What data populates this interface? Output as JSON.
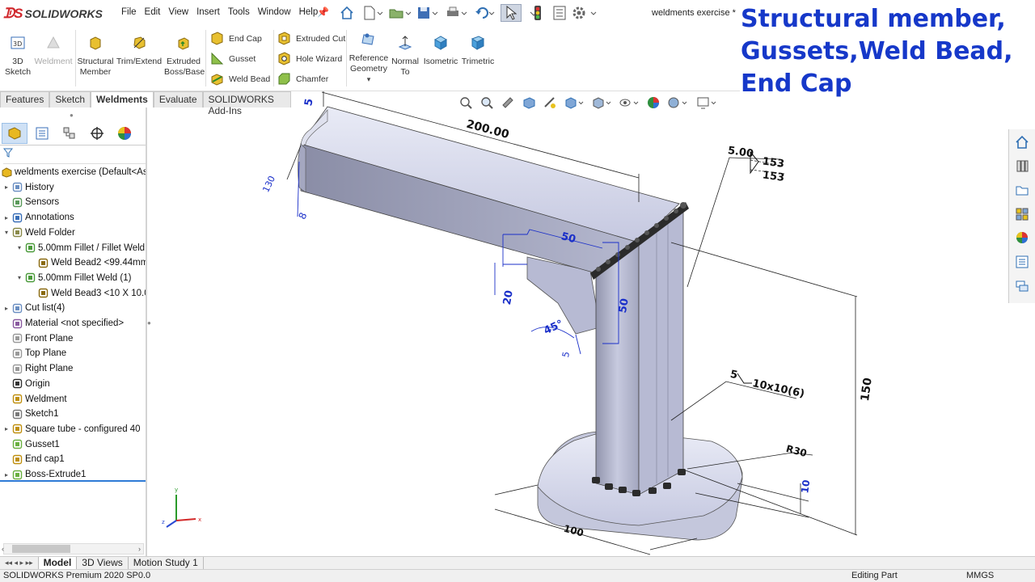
{
  "app": {
    "logo_text": "SOLIDWORKS",
    "document_title": "weldments exercise *",
    "overlay_title": [
      "Structural member,",
      "Gussets,Weld Bead,",
      "End Cap"
    ]
  },
  "menu": [
    "File",
    "Edit",
    "View",
    "Insert",
    "Tools",
    "Window",
    "Help"
  ],
  "quick_access_icons": [
    "home-icon",
    "new-document-icon",
    "open-icon",
    "save-icon",
    "print-icon",
    "undo-icon",
    "select-icon",
    "rebuild-icon",
    "file-properties-icon",
    "options-icon"
  ],
  "ribbon": {
    "sketch_3d": [
      "3D",
      "Sketch"
    ],
    "weldment": "Weldment",
    "structural_member": [
      "Structural",
      "Member"
    ],
    "trim_extend": "Trim/Extend",
    "extruded_boss": [
      "Extruded",
      "Boss/Base"
    ],
    "end_cap": "End Cap",
    "gusset": "Gusset",
    "weld_bead": "Weld Bead",
    "extruded_cut": "Extruded Cut",
    "hole_wizard": "Hole Wizard",
    "chamfer": "Chamfer",
    "reference_geometry": [
      "Reference",
      "Geometry"
    ],
    "normal_to": [
      "Normal",
      "To"
    ],
    "isometric": "Isometric",
    "trimetric": "Trimetric"
  },
  "command_tabs": [
    {
      "label": "Features",
      "active": false
    },
    {
      "label": "Sketch",
      "active": false
    },
    {
      "label": "Weldments",
      "active": true
    },
    {
      "label": "Evaluate",
      "active": false
    },
    {
      "label": "SOLIDWORKS Add-Ins",
      "active": false
    }
  ],
  "feature_tree": {
    "root": "weldments exercise  (Default<As",
    "items": [
      {
        "label": "History",
        "icon": "history-icon",
        "expander": "▸",
        "indent": 0
      },
      {
        "label": "Sensors",
        "icon": "sensors-icon",
        "expander": "",
        "indent": 0
      },
      {
        "label": "Annotations",
        "icon": "annotations-icon",
        "expander": "▸",
        "indent": 0
      },
      {
        "label": "Weld Folder",
        "icon": "weld-folder-icon",
        "expander": "▾",
        "indent": 0
      },
      {
        "label": "5.00mm Fillet / Fillet Weld",
        "icon": "fillet-weld-icon",
        "expander": "▾",
        "indent": 1
      },
      {
        "label": "Weld Bead2 <99.44mm",
        "icon": "weld-bead-icon",
        "expander": "",
        "indent": 2
      },
      {
        "label": "5.00mm Fillet Weld (1)",
        "icon": "fillet-weld-icon",
        "expander": "▾",
        "indent": 1
      },
      {
        "label": "Weld Bead3 <10 X 10.0",
        "icon": "weld-bead-icon",
        "expander": "",
        "indent": 2
      },
      {
        "label": "Cut list(4)",
        "icon": "cut-list-icon",
        "expander": "▸",
        "indent": 0
      },
      {
        "label": "Material <not specified>",
        "icon": "material-icon",
        "expander": "",
        "indent": 0
      },
      {
        "label": "Front Plane",
        "icon": "plane-icon",
        "expander": "",
        "indent": 0
      },
      {
        "label": "Top Plane",
        "icon": "plane-icon",
        "expander": "",
        "indent": 0
      },
      {
        "label": "Right Plane",
        "icon": "plane-icon",
        "expander": "",
        "indent": 0
      },
      {
        "label": "Origin",
        "icon": "origin-icon",
        "expander": "",
        "indent": 0
      },
      {
        "label": "Weldment",
        "icon": "weldment-icon",
        "expander": "",
        "indent": 0
      },
      {
        "label": "Sketch1",
        "icon": "sketch-icon",
        "expander": "",
        "indent": 0
      },
      {
        "label": "Square tube - configured 40",
        "icon": "structural-member-icon",
        "expander": "▸",
        "indent": 0
      },
      {
        "label": "Gusset1",
        "icon": "gusset-icon",
        "expander": "",
        "indent": 0
      },
      {
        "label": "End cap1",
        "icon": "end-cap-icon",
        "expander": "",
        "indent": 0
      },
      {
        "label": "Boss-Extrude1",
        "icon": "boss-extrude-icon",
        "expander": "▸",
        "indent": 0
      }
    ]
  },
  "dimensions": {
    "d5_top": "5",
    "d200": "200.00",
    "d130": "130",
    "d8": "8",
    "d50_h": "50",
    "d20": "20",
    "d50_v": "50",
    "d45": "45°",
    "d5_gusset": "5",
    "d150": "150",
    "r30": "R30",
    "d10": "10",
    "d100": "100",
    "weld_top_size": "5.00",
    "weld_top_len_a": "153",
    "weld_top_len_b": "153",
    "weld_bottom_size": "5",
    "weld_bottom_spec": "10x10(6)"
  },
  "triad": {
    "x": "x",
    "y": "y",
    "z": "z"
  },
  "bottom_tabs": [
    {
      "label": "Model",
      "active": true
    },
    {
      "label": "3D Views",
      "active": false
    },
    {
      "label": "Motion Study 1",
      "active": false
    }
  ],
  "status": {
    "version": "SOLIDWORKS Premium 2020 SP0.0",
    "mode": "Editing Part",
    "units": "MMGS"
  },
  "colors": {
    "accent": "#2f7bd6",
    "overlay_text": "#1638c9",
    "dimension_blue": "#1a2fc9",
    "part_body": "#b9bcd6",
    "weld_bead": "#2b2b2b"
  }
}
